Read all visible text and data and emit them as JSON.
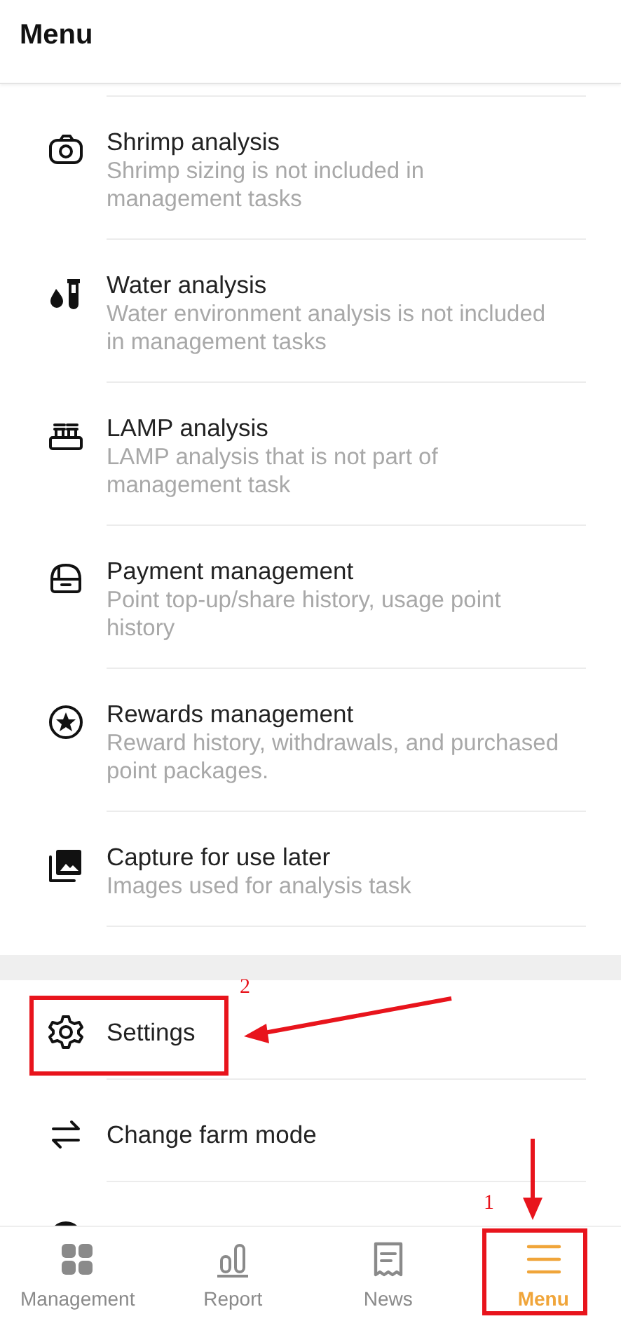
{
  "header": {
    "title": "Menu"
  },
  "sections": [
    {
      "items": [
        {
          "title": "Shrimp analysis",
          "description": "Shrimp sizing is not included in management tasks"
        },
        {
          "title": "Water analysis",
          "description": "Water environment analysis is not included in management tasks"
        },
        {
          "title": "LAMP analysis",
          "description": "LAMP analysis that is not part of management task"
        },
        {
          "title": "Payment management",
          "description": "Point top-up/share history, usage point history"
        },
        {
          "title": "Rewards management",
          "description": "Reward history, withdrawals, and purchased point packages."
        },
        {
          "title": "Capture for use later",
          "description": "Images used for analysis task"
        }
      ]
    },
    {
      "items": [
        {
          "kind": "link",
          "title": "Settings"
        },
        {
          "kind": "link",
          "title": "Change farm mode"
        },
        {
          "kind": "cut"
        }
      ]
    }
  ],
  "bottom_nav": [
    {
      "label": "Management",
      "selected": false
    },
    {
      "label": "Report",
      "selected": false
    },
    {
      "label": "News",
      "selected": false
    },
    {
      "label": "Menu",
      "selected": true
    }
  ],
  "annotations": [
    {
      "label": "1"
    },
    {
      "label": "2"
    }
  ]
}
